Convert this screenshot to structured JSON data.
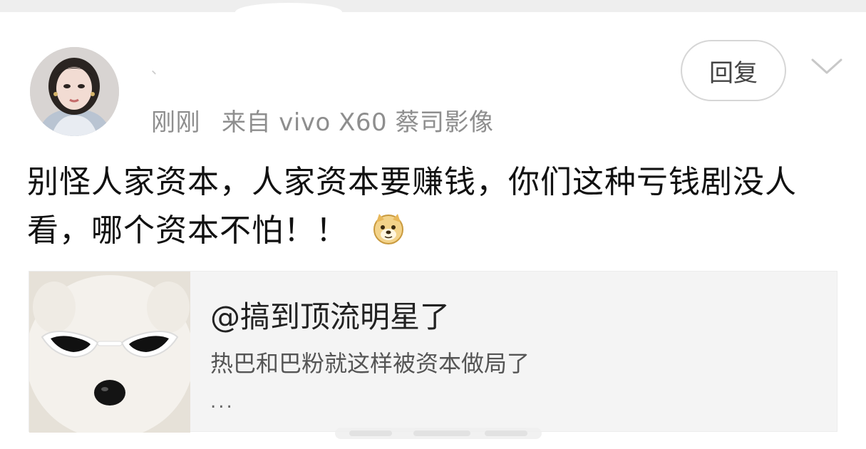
{
  "post": {
    "username": "、",
    "time": "刚刚",
    "source": "来自 vivo X60 蔡司影像",
    "reply_label": "回复",
    "text": "别怪人家资本，人家资本要赚钱，你们这种亏钱剧没人看，哪个资本不怕！！",
    "emoji_icon": "doge-icon"
  },
  "quoted": {
    "title": "@搞到顶流明星了",
    "subtitle": "热巴和巴粉就这样被资本做局了",
    "ellipsis": "..."
  },
  "colors": {
    "meta_gray": "#8e8e8e",
    "card_bg": "#f4f4f4",
    "border": "#d6d6d6"
  }
}
